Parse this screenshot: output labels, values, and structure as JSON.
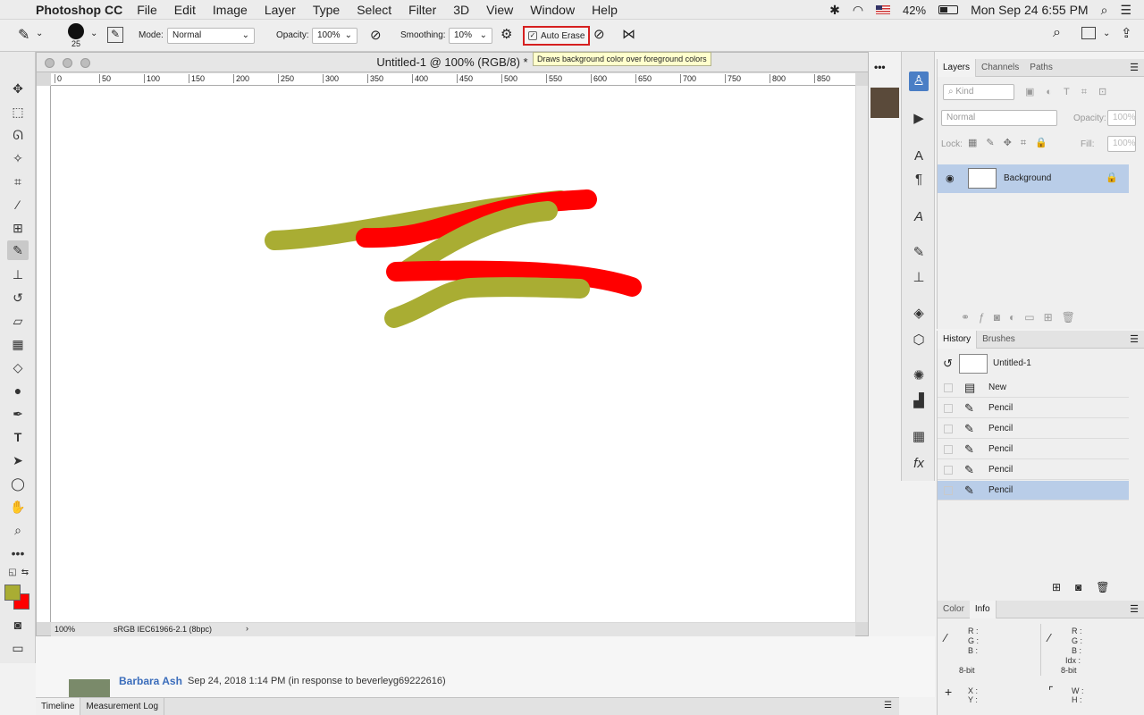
{
  "menubar": {
    "app_name": "Photoshop CC",
    "items": [
      "File",
      "Edit",
      "Image",
      "Layer",
      "Type",
      "Select",
      "Filter",
      "3D",
      "View",
      "Window",
      "Help"
    ],
    "battery": "42%",
    "datetime": "Mon Sep 24  6:55 PM"
  },
  "options": {
    "brush_size": "25",
    "mode_label": "Mode:",
    "mode_value": "Normal",
    "opacity_label": "Opacity:",
    "opacity_value": "100%",
    "smoothing_label": "Smoothing:",
    "smoothing_value": "10%",
    "auto_erase_label": "Auto Erase",
    "tooltip": "Draws background color over foreground colors"
  },
  "colors": {
    "foreground": "#a9ad33",
    "background": "#ff0000",
    "selection": "#b9cde8"
  },
  "document": {
    "title": "Untitled-1 @ 100% (RGB/8) *",
    "ruler_marks": [
      "0",
      "50",
      "100",
      "150",
      "200",
      "250",
      "300",
      "350",
      "400",
      "450",
      "500",
      "550",
      "600",
      "650",
      "700",
      "750",
      "800",
      "850"
    ],
    "zoom": "100%",
    "profile": "sRGB IEC61966-2.1 (8bpc)"
  },
  "layers_panel": {
    "tabs": [
      "Layers",
      "Channels",
      "Paths"
    ],
    "kind_label": "Kind",
    "blend": "Normal",
    "opacity_label": "Opacity:",
    "opacity_value": "100%",
    "lock_label": "Lock:",
    "fill_label": "Fill:",
    "fill_value": "100%",
    "layer_name": "Background"
  },
  "history_panel": {
    "tabs": [
      "History",
      "Brushes"
    ],
    "snapshot": "Untitled-1",
    "items": [
      "New",
      "Pencil",
      "Pencil",
      "Pencil",
      "Pencil",
      "Pencil"
    ]
  },
  "info_panel": {
    "tabs": [
      "Color",
      "Info"
    ],
    "r": "R :",
    "g": "G :",
    "b": "B :",
    "idx": "Idx :",
    "bit1": "8-bit",
    "bit2": "8-bit",
    "x": "X :",
    "y": "Y :",
    "w": "W :",
    "h": "H :"
  },
  "background_page": {
    "commenter": "Barbara Ash",
    "meta": "Sep 24, 2018 1:14 PM   (in response to beverleyg69222616)"
  },
  "bottom_tabs": [
    "Timeline",
    "Measurement Log"
  ]
}
